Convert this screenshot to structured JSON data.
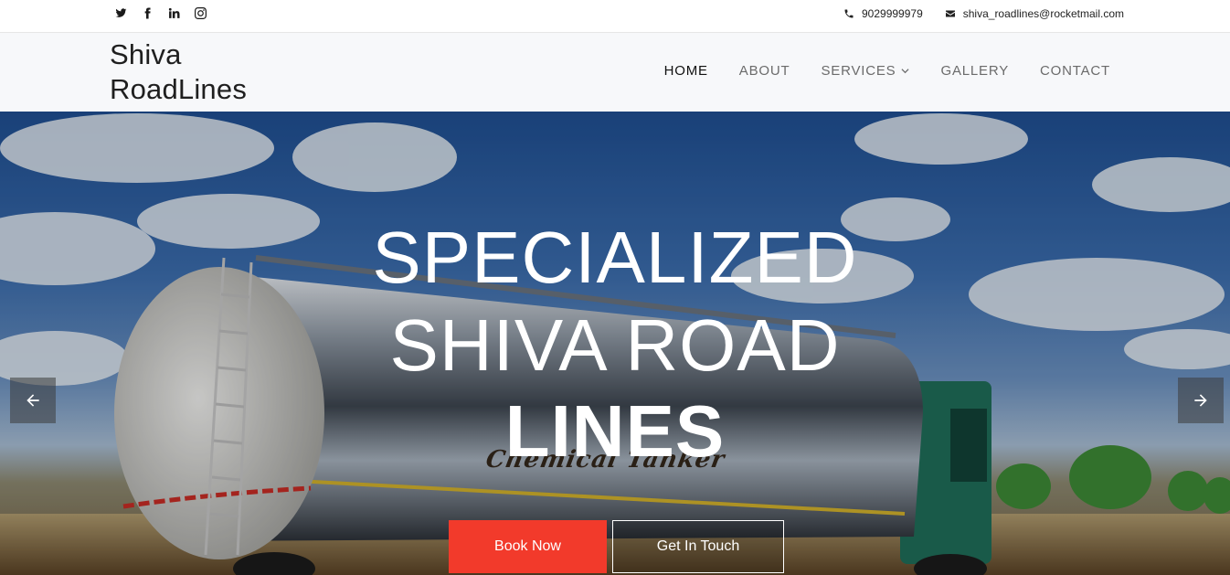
{
  "topbar": {
    "social": [
      {
        "icon": "twitter-icon"
      },
      {
        "icon": "facebook-icon"
      },
      {
        "icon": "linkedin-icon"
      },
      {
        "icon": "instagram-icon"
      }
    ],
    "phone": "9029999979",
    "email": "shiva_roadlines@rocketmail.com"
  },
  "nav": {
    "brand_line1": "Shiva",
    "brand_line2": "RoadLines",
    "items": [
      {
        "label": "HOME"
      },
      {
        "label": "ABOUT"
      },
      {
        "label": "SERVICES"
      },
      {
        "label": "GALLERY"
      },
      {
        "label": "CONTACT"
      }
    ]
  },
  "hero": {
    "line1": "SPECIALIZED",
    "line2": "SHIVA ROAD",
    "line3": "LINES",
    "tank_text": "Chemical Tanker",
    "primary_button": "Book Now",
    "secondary_button": "Get In Touch"
  },
  "colors": {
    "accent": "#f23a2b",
    "nav_bg": "#f7f8fa"
  }
}
